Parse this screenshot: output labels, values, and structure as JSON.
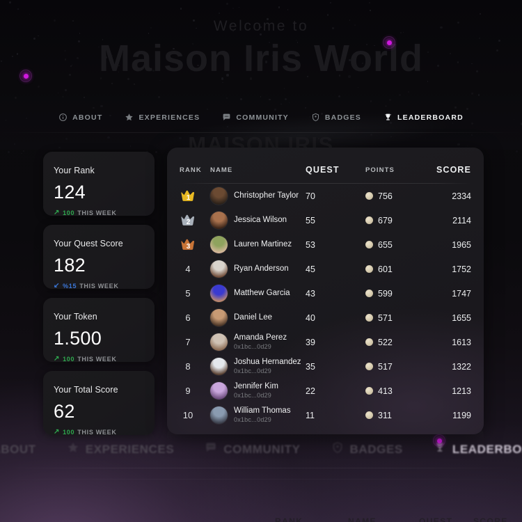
{
  "hero": {
    "welcome": "Welcome to",
    "title": "Maison Iris World",
    "watermark": "MAISON IRIS"
  },
  "top_nav": {
    "items": [
      {
        "label": "ABOUT",
        "icon": "info-icon",
        "active": false
      },
      {
        "label": "EXPERIENCES",
        "icon": "star-icon",
        "active": false
      },
      {
        "label": "COMMUNITY",
        "icon": "chat-icon",
        "active": false
      },
      {
        "label": "BADGES",
        "icon": "shield-icon",
        "active": false
      },
      {
        "label": "LEADERBOARD",
        "icon": "trophy-icon",
        "active": true
      }
    ]
  },
  "bottom_nav": {
    "items": [
      {
        "label": "ABOUT",
        "icon": "info-icon",
        "active": false
      },
      {
        "label": "EXPERIENCES",
        "icon": "star-icon",
        "active": false
      },
      {
        "label": "COMMUNITY",
        "icon": "chat-icon",
        "active": false
      },
      {
        "label": "BADGES",
        "icon": "shield-icon",
        "active": false
      },
      {
        "label": "LEADERBOARD",
        "icon": "trophy-icon",
        "active": true
      }
    ]
  },
  "ghost_headers": {
    "rank": "RANK",
    "name": "NAME",
    "quest": "QUEST",
    "score": "SCORE"
  },
  "stats": {
    "cards": [
      {
        "label": "Your Rank",
        "value": "124",
        "trend_dir": "up",
        "trend_value": "100",
        "trend_period": "THIS WEEK",
        "trend_color": "#2fa84f",
        "arrow": "↗"
      },
      {
        "label": "Your Quest Score",
        "value": "182",
        "trend_dir": "down",
        "trend_value": "%15",
        "trend_period": "THIS WEEK",
        "trend_color": "#3a76d8",
        "arrow": "↙"
      },
      {
        "label": "Your Token",
        "value": "1.500",
        "trend_dir": "up",
        "trend_value": "100",
        "trend_period": "THIS WEEK",
        "trend_color": "#2fa84f",
        "arrow": "↗"
      },
      {
        "label": "Your Total Score",
        "value": "62",
        "trend_dir": "up",
        "trend_value": "100",
        "trend_period": "THIS WEEK",
        "trend_color": "#2fa84f",
        "arrow": "↗"
      }
    ]
  },
  "leaderboard": {
    "columns": {
      "rank": "RANK",
      "name": "NAME",
      "quest": "QUEST",
      "points": "POINTS",
      "score": "SCORE"
    },
    "rows": [
      {
        "rank": "1",
        "badge": "gold-crown",
        "name": "Christopher Taylor",
        "address": "",
        "quest": "70",
        "points": "756",
        "score": "2334",
        "avatar_a": "#6b4a32",
        "avatar_b": "#2b2119"
      },
      {
        "rank": "2",
        "badge": "silver-crown",
        "name": "Jessica Wilson",
        "address": "",
        "quest": "55",
        "points": "679",
        "score": "2114",
        "avatar_a": "#a8714d",
        "avatar_b": "#3a2418"
      },
      {
        "rank": "3",
        "badge": "bronze-crown",
        "name": "Lauren Martinez",
        "address": "",
        "quest": "53",
        "points": "655",
        "score": "1965",
        "avatar_a": "#8fa35e",
        "avatar_b": "#d8b79c"
      },
      {
        "rank": "4",
        "badge": "",
        "name": "Ryan Anderson",
        "address": "",
        "quest": "45",
        "points": "601",
        "score": "1752",
        "avatar_a": "#d9d4cd",
        "avatar_b": "#6e4a36"
      },
      {
        "rank": "5",
        "badge": "",
        "name": "Matthew Garcia",
        "address": "",
        "quest": "43",
        "points": "599",
        "score": "1747",
        "avatar_a": "#3a3ad0",
        "avatar_b": "#c08a6a"
      },
      {
        "rank": "6",
        "badge": "",
        "name": "Daniel Lee",
        "address": "",
        "quest": "40",
        "points": "571",
        "score": "1655",
        "avatar_a": "#c79a74",
        "avatar_b": "#4a3526"
      },
      {
        "rank": "7",
        "badge": "",
        "name": "Amanda Perez",
        "address": "0x1bc...0d29",
        "quest": "39",
        "points": "522",
        "score": "1613",
        "avatar_a": "#cfc2b4",
        "avatar_b": "#8a6a52"
      },
      {
        "rank": "8",
        "badge": "",
        "name": "Joshua Hernandez",
        "address": "0x1bc...0d29",
        "quest": "35",
        "points": "517",
        "score": "1322",
        "avatar_a": "#e4e8ec",
        "avatar_b": "#5a4030"
      },
      {
        "rank": "9",
        "badge": "",
        "name": "Jennifer Kim",
        "address": "0x1bc...0d29",
        "quest": "22",
        "points": "413",
        "score": "1213",
        "avatar_a": "#c9a6dc",
        "avatar_b": "#6a4a7a"
      },
      {
        "rank": "10",
        "badge": "",
        "name": "William Thomas",
        "address": "0x1bc...0d29",
        "quest": "11",
        "points": "311",
        "score": "1199",
        "avatar_a": "#8a9bb0",
        "avatar_b": "#3a3e4a"
      }
    ]
  },
  "colors": {
    "accent_magenta": "#d018e0",
    "gold": "#e8b923",
    "silver": "#a8b0ba",
    "bronze": "#c87437",
    "coin": "#d7ccb0",
    "up": "#2fa84f",
    "down": "#3a76d8"
  }
}
